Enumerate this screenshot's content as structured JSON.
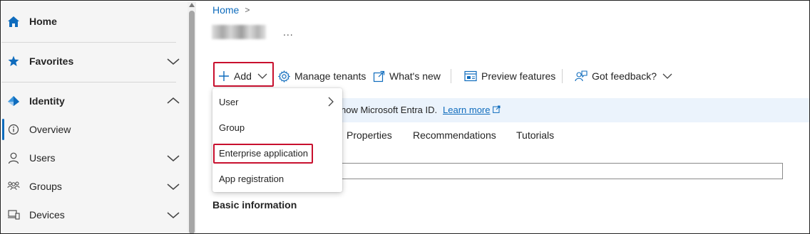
{
  "sidebar": {
    "items": [
      {
        "label": "Home",
        "icon": "home-icon"
      },
      {
        "label": "Favorites",
        "icon": "star-icon"
      },
      {
        "label": "Identity",
        "icon": "identity-icon"
      },
      {
        "label": "Overview",
        "icon": "info-icon"
      },
      {
        "label": "Users",
        "icon": "user-icon"
      },
      {
        "label": "Groups",
        "icon": "groups-icon"
      },
      {
        "label": "Devices",
        "icon": "devices-icon"
      }
    ]
  },
  "breadcrumb": {
    "home": "Home",
    "separator": ">"
  },
  "header": {
    "more_label": "..."
  },
  "toolbar": {
    "add_label": "Add",
    "manage_tenants_label": "Manage tenants",
    "whats_new_label": "What's new",
    "preview_features_label": "Preview features",
    "feedback_label": "Got feedback?"
  },
  "add_menu": {
    "items": [
      "User",
      "Group",
      "Enterprise application",
      "App registration"
    ],
    "highlighted": "Enterprise application"
  },
  "banner": {
    "text": "now Microsoft Entra ID.",
    "link": "Learn more"
  },
  "tabs": [
    "Properties",
    "Recommendations",
    "Tutorials"
  ],
  "section": {
    "title": "Basic information"
  },
  "colors": {
    "accent": "#0f6cbd",
    "highlight_box": "#c8102e",
    "sidebar_bg": "#f5f5f5",
    "banner_bg": "#ebf3fc"
  }
}
